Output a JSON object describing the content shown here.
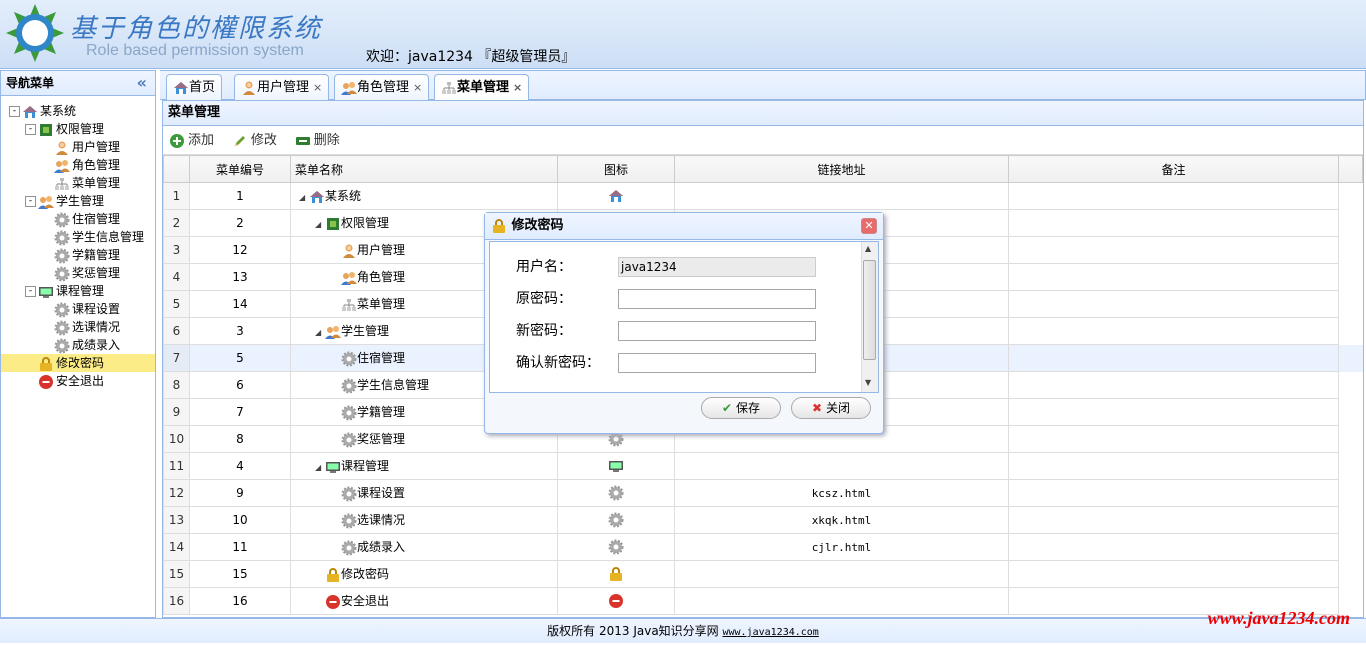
{
  "header": {
    "title_cn": "基于角色的權限系统",
    "title_en": "Role based permission system",
    "welcome": "欢迎：java1234 『超级管理员』"
  },
  "sidebar": {
    "title": "导航菜单",
    "collapse": "«",
    "tree": [
      {
        "label": "某系统",
        "icon": "home-icon",
        "level": 0,
        "toggle": "-"
      },
      {
        "label": "权限管理",
        "icon": "green-square-icon",
        "level": 1,
        "toggle": "-"
      },
      {
        "label": "用户管理",
        "icon": "user-icon",
        "level": 2
      },
      {
        "label": "角色管理",
        "icon": "users-icon",
        "level": 2
      },
      {
        "label": "菜单管理",
        "icon": "sitemap-icon",
        "level": 2
      },
      {
        "label": "学生管理",
        "icon": "users-icon",
        "level": 1,
        "toggle": "-"
      },
      {
        "label": "住宿管理",
        "icon": "gear-icon",
        "level": 2
      },
      {
        "label": "学生信息管理",
        "icon": "gear-icon",
        "level": 2
      },
      {
        "label": "学籍管理",
        "icon": "gear-icon",
        "level": 2
      },
      {
        "label": "奖惩管理",
        "icon": "gear-icon",
        "level": 2
      },
      {
        "label": "课程管理",
        "icon": "monitor-icon",
        "level": 1,
        "toggle": "-"
      },
      {
        "label": "课程设置",
        "icon": "gear-icon",
        "level": 2
      },
      {
        "label": "选课情况",
        "icon": "gear-icon",
        "level": 2
      },
      {
        "label": "成绩录入",
        "icon": "gear-icon",
        "level": 2
      },
      {
        "label": "修改密码",
        "icon": "lock-icon",
        "level": 1,
        "selected": true
      },
      {
        "label": "安全退出",
        "icon": "exit-icon",
        "level": 1
      }
    ]
  },
  "tabs": [
    {
      "label": "首页",
      "icon": "home-icon",
      "closable": false
    },
    {
      "label": "用户管理",
      "icon": "user-icon",
      "closable": true
    },
    {
      "label": "角色管理",
      "icon": "users-icon",
      "closable": true
    },
    {
      "label": "菜单管理",
      "icon": "sitemap-icon",
      "closable": true,
      "active": true
    }
  ],
  "panel": {
    "title": "菜单管理",
    "toolbar": {
      "add": "添加",
      "edit": "修改",
      "delete": "删除"
    },
    "columns": [
      "菜单编号",
      "菜单名称",
      "图标",
      "链接地址",
      "备注"
    ],
    "rows": [
      {
        "rn": "1",
        "id": "1",
        "name": "某系统",
        "depth": 0,
        "expand": true,
        "icon": "home-icon",
        "url": ""
      },
      {
        "rn": "2",
        "id": "2",
        "name": "权限管理",
        "depth": 1,
        "expand": true,
        "icon": "green-square-icon",
        "url": ""
      },
      {
        "rn": "3",
        "id": "12",
        "name": "用户管理",
        "depth": 2,
        "icon": "user-icon",
        "url": ""
      },
      {
        "rn": "4",
        "id": "13",
        "name": "角色管理",
        "depth": 2,
        "icon": "users-icon",
        "url": ""
      },
      {
        "rn": "5",
        "id": "14",
        "name": "菜单管理",
        "depth": 2,
        "icon": "sitemap-icon",
        "url": ""
      },
      {
        "rn": "6",
        "id": "3",
        "name": "学生管理",
        "depth": 1,
        "expand": true,
        "icon": "users-icon",
        "url": ""
      },
      {
        "rn": "7",
        "id": "5",
        "name": "住宿管理",
        "depth": 2,
        "icon": "gear-icon",
        "url": "",
        "highlight": true
      },
      {
        "rn": "8",
        "id": "6",
        "name": "学生信息管理",
        "depth": 2,
        "icon": "gear-icon",
        "url": ""
      },
      {
        "rn": "9",
        "id": "7",
        "name": "学籍管理",
        "depth": 2,
        "icon": "gear-icon",
        "url": ""
      },
      {
        "rn": "10",
        "id": "8",
        "name": "奖惩管理",
        "depth": 2,
        "icon": "gear-icon",
        "url": ""
      },
      {
        "rn": "11",
        "id": "4",
        "name": "课程管理",
        "depth": 1,
        "expand": true,
        "icon": "monitor-icon",
        "url": ""
      },
      {
        "rn": "12",
        "id": "9",
        "name": "课程设置",
        "depth": 2,
        "icon": "gear-icon",
        "url": "kcsz.html"
      },
      {
        "rn": "13",
        "id": "10",
        "name": "选课情况",
        "depth": 2,
        "icon": "gear-icon",
        "url": "xkqk.html"
      },
      {
        "rn": "14",
        "id": "11",
        "name": "成绩录入",
        "depth": 2,
        "icon": "gear-icon",
        "url": "cjlr.html"
      },
      {
        "rn": "15",
        "id": "15",
        "name": "修改密码",
        "depth": 1,
        "icon": "lock-icon",
        "url": ""
      },
      {
        "rn": "16",
        "id": "16",
        "name": "安全退出",
        "depth": 1,
        "icon": "exit-icon",
        "url": ""
      }
    ]
  },
  "dialog": {
    "title": "修改密码",
    "username_label": "用户名：",
    "username_value": "java1234",
    "old_pwd_label": "原密码：",
    "new_pwd_label": "新密码：",
    "confirm_pwd_label": "确认新密码：",
    "save": "保存",
    "close": "关闭"
  },
  "footer": {
    "text": "版权所有 2013 Java知识分享网 ",
    "link": "www.java1234.com"
  },
  "watermark": "www.java1234.com",
  "colors": {
    "border": "#95b8e7",
    "header_bg": "#e0ecff",
    "selected": "#fbec88",
    "accent": "#3a78c3"
  }
}
